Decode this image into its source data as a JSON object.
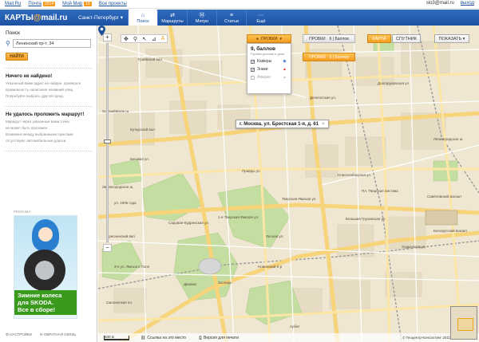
{
  "portal": {
    "links": [
      "Mail.Ru",
      "Почта",
      "Мой Мир",
      "Все проекты"
    ],
    "mail_badge": "2914",
    "myworld_badge": "16",
    "user_email": "sio3@mail.ru",
    "logout": "выход"
  },
  "header": {
    "logo_left": "КАРТЫ",
    "logo_right": "mail.ru",
    "city": "Санкт-Петербург",
    "tabs": [
      {
        "label": "Поиск",
        "icon": "home-icon",
        "active": true
      },
      {
        "label": "Маршруты",
        "icon": "route-icon",
        "active": false
      },
      {
        "label": "Метро",
        "icon": "metro-icon",
        "active": false
      },
      {
        "label": "Статьи",
        "icon": "article-icon",
        "active": false
      },
      {
        "label": "Ещё",
        "icon": "more-icon",
        "active": false
      }
    ]
  },
  "sidebar": {
    "search_label": "Поиск",
    "search_value": "Ленинский пр-т, 34",
    "find_button": "НАЙТИ",
    "not_found": {
      "title": "Ничего не найдено!",
      "lines": [
        "Указанный вами адрес не найден, проверьте",
        "правильность написания названий улиц.",
        "Попробуйте выбрать другой город."
      ]
    },
    "no_route": {
      "title": "Не удалось проложить маршрут!",
      "lines": [
        "Маршрут через указанные вами точки",
        "не может быть проложен.",
        "Возможно между выбранными пунктами",
        "отсутствуют автомобильные дороги."
      ]
    },
    "ad_label": "РЕКЛАМА",
    "ad_text": [
      "Зимние колеса",
      "для SKODA.",
      "Все в сборе!"
    ],
    "footer": [
      "НАСТРОЙКИ",
      "ОБРАТНАЯ СВЯЗЬ"
    ]
  },
  "map": {
    "traffic_dropdown": "ПРОБКИ",
    "traffic_score": "9, баллов",
    "traffic_sub": "Пробки длиною в день",
    "traffic_options": [
      {
        "label": "Камеры",
        "checked": true,
        "icon": "camera-icon"
      },
      {
        "label": "Знаки",
        "checked": true,
        "icon": "warning-sign-icon"
      },
      {
        "label": "Аварии",
        "checked": false,
        "icon": "accident-icon"
      }
    ],
    "traffic_tab_1": {
      "label": "ПРОБКИ",
      "score": "6 | Баллов"
    },
    "traffic_tab_2": {
      "label": "ПРОБКИ",
      "score": "6 | Баллов"
    },
    "view_buttons": [
      "КАРТА",
      "СПУТНИК"
    ],
    "show_button": "ПОКАЗАТЬ",
    "address_popup": "г. Москва, ул. Брестская 1-я, д. 61",
    "scale": "500 м",
    "bottom_links": [
      "Ссылка на это место",
      "Версия для печати"
    ],
    "copyright": "© Геоцентр-Консалтинг 2011",
    "street_labels": [
      "Грайвский вал",
      "Делегатская ул.",
      "Долгоруковская ул.",
      "Новослободская ул.",
      "Тверская-Ямская ул.",
      "1-я Тверская-Ямская ул.",
      "Лесная ул.",
      "Бутырский вал",
      "Садовая-Кудринская ул.",
      "Большая Грузинская ул.",
      "Пресненский вал",
      "Звенигородское ш.",
      "Новинский б-р",
      "Арбат",
      "Смоленская пл.",
      "Пл. Тверская Застава",
      "Белорусский вокзал",
      "Зоопарк",
      "Динамо",
      "Савёловский вокзал",
      "Ленинградское ш.",
      "Беговая ул.",
      "Хорошёвское ш.",
      "3-я ул. Ямского Поля",
      "Правды ул.",
      "Ходынская ул.",
      "ул. 1905 года"
    ]
  }
}
